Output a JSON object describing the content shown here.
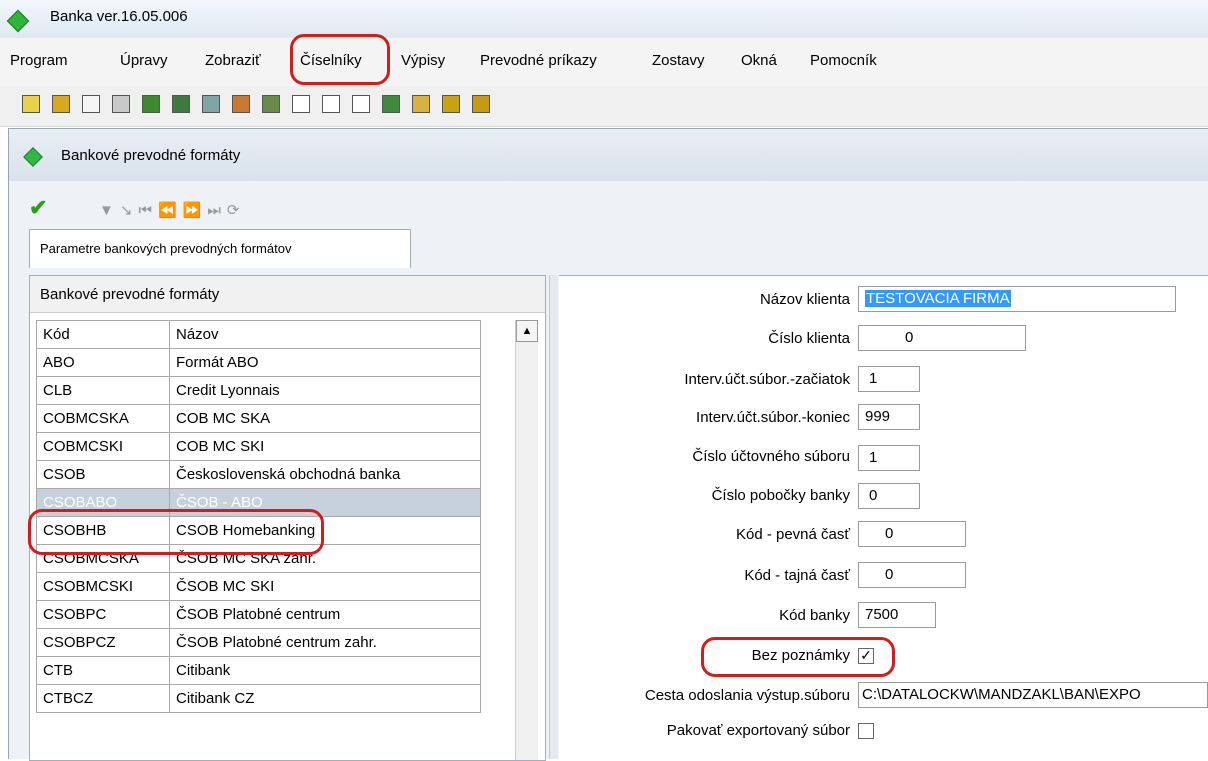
{
  "window": {
    "title": "Banka ver.16.05.006"
  },
  "menu": [
    "Program",
    "Úpravy",
    "Zobraziť",
    "Číselníky",
    "Výpisy",
    "Prevodné príkazy",
    "Zostavy",
    "Okná",
    "Pomocník"
  ],
  "child": {
    "title": "Bankové prevodné formáty",
    "tab": "Parametre bankových prevodných formátov"
  },
  "left": {
    "header": "Bankové prevodné formáty",
    "columns": [
      "Kód",
      "Názov"
    ],
    "rows": [
      {
        "code": "ABO",
        "name": "Formát ABO"
      },
      {
        "code": "CLB",
        "name": "Credit Lyonnais"
      },
      {
        "code": "COBMCSKA",
        "name": "COB MC SKA"
      },
      {
        "code": "COBMCSKI",
        "name": "COB MC SKI"
      },
      {
        "code": "CSOB",
        "name": "Československá obchodná banka"
      },
      {
        "code": "CSOBABO",
        "name": "ČSOB - ABO"
      },
      {
        "code": "CSOBHB",
        "name": "CSOB Homebanking"
      },
      {
        "code": "CSOBMCSKA",
        "name": "ČSOB MC SKA zahr."
      },
      {
        "code": "CSOBMCSKI",
        "name": "ČSOB MC SKI"
      },
      {
        "code": "CSOBPC",
        "name": "ČSOB Platobné centrum"
      },
      {
        "code": "CSOBPCZ",
        "name": "ČSOB Platobné centrum zahr."
      },
      {
        "code": "CTB",
        "name": "Citibank"
      },
      {
        "code": "CTBCZ",
        "name": "Citibank CZ"
      }
    ]
  },
  "form": {
    "nazov_klienta": {
      "label": "Názov klienta",
      "value": "TESTOVACIA FIRMA"
    },
    "cislo_klienta": {
      "label": "Číslo klienta",
      "value": "0"
    },
    "interv_zac": {
      "label": "Interv.účt.súbor.-začiatok",
      "value": "1"
    },
    "interv_kon": {
      "label": "Interv.účt.súbor.-koniec",
      "value": "999"
    },
    "cislo_uct": {
      "label": "Číslo účtovného súboru",
      "value": "1"
    },
    "pobocka": {
      "label": "Číslo pobočky banky",
      "value": "0"
    },
    "kod_pevna": {
      "label": "Kód - pevná časť",
      "value": "0"
    },
    "kod_tajna": {
      "label": "Kód - tajná časť",
      "value": "0"
    },
    "kod_banky": {
      "label": "Kód banky",
      "value": "7500"
    },
    "bez_poznamky": {
      "label": "Bez poznámky",
      "checked": "✓"
    },
    "cesta": {
      "label": "Cesta odoslania výstup.súboru",
      "value": "C:\\DATALOCKW\\MANDZAKL\\BAN\\EXPO"
    },
    "pakovat": {
      "label": "Pakovať exportovaný súbor"
    }
  }
}
